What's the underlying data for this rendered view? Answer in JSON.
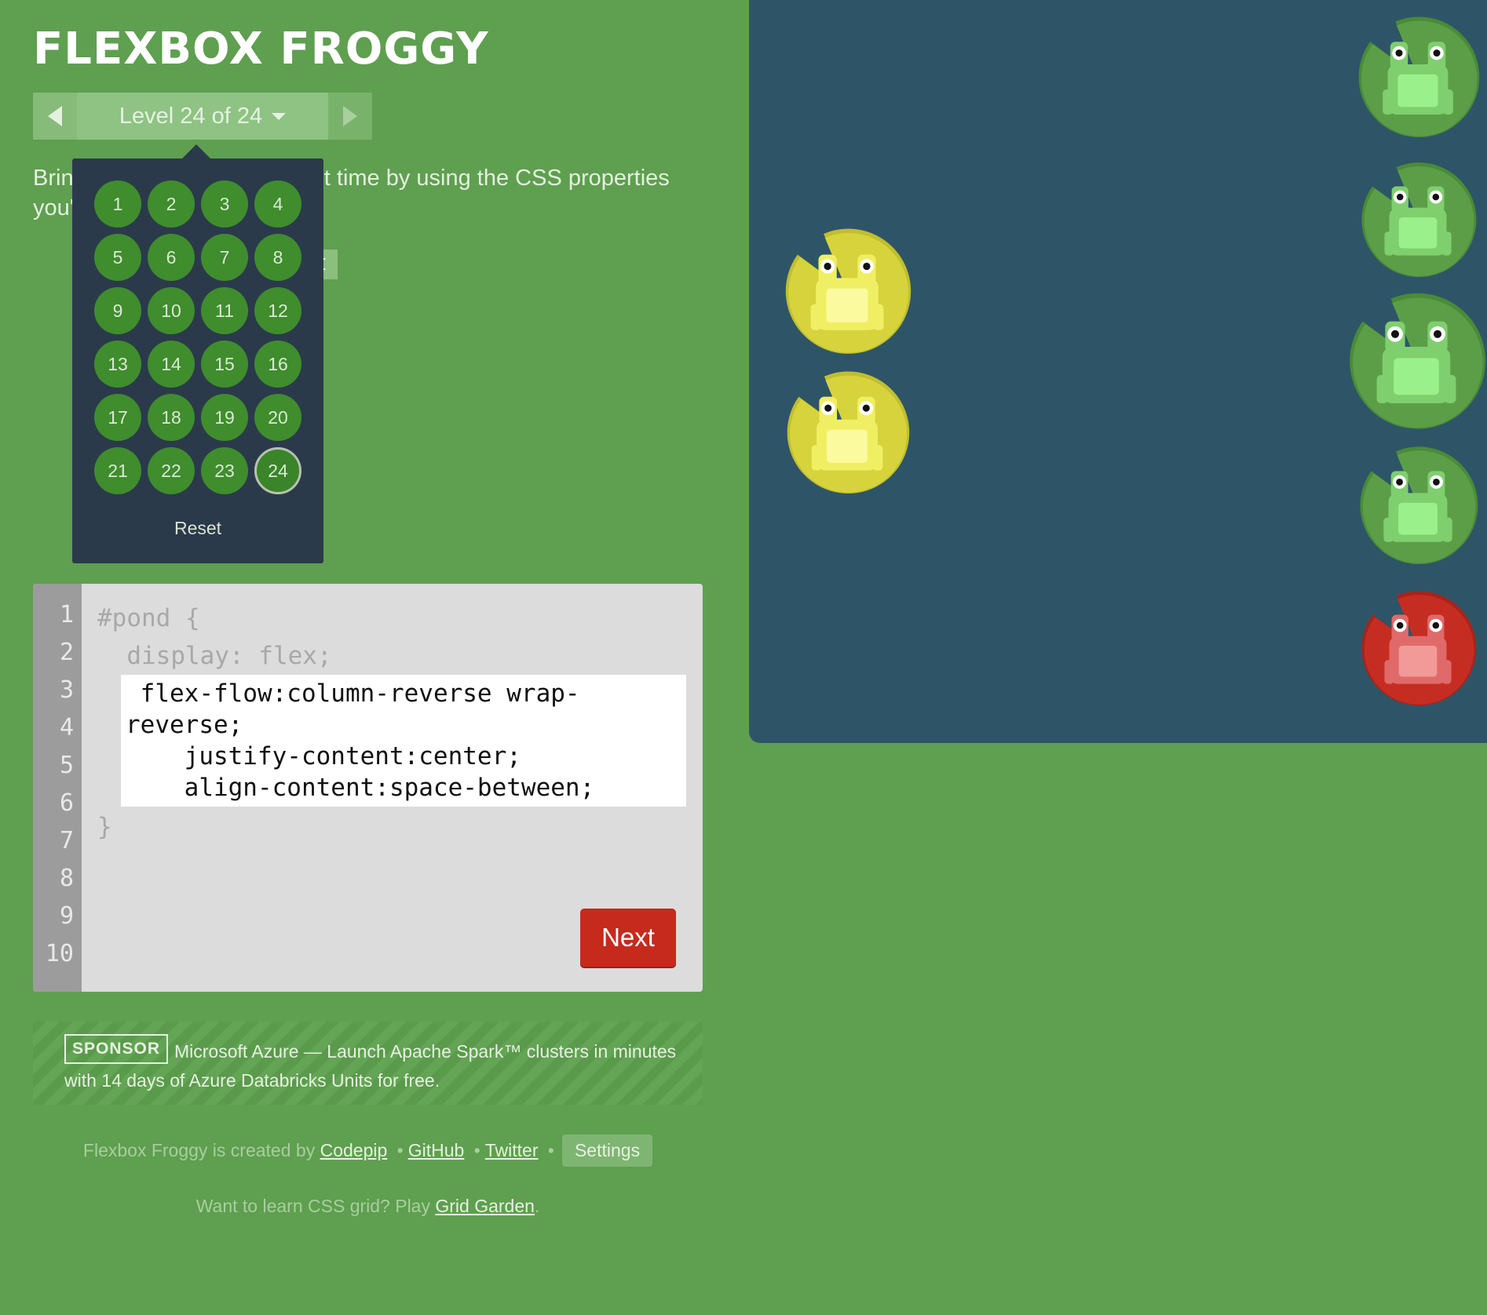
{
  "app": {
    "title": "FLEXBOX FROGGY"
  },
  "level_nav": {
    "prev_icon": "triangle-left-icon",
    "next_icon": "triangle-right-icon",
    "label": "Level 24 of 24",
    "caret_icon": "caret-down-icon"
  },
  "instructions": {
    "text": "Bring the frogs home one last time by using the CSS properties you've learned:"
  },
  "code_hint": {
    "text": "t"
  },
  "level_menu": {
    "levels": [
      "1",
      "2",
      "3",
      "4",
      "5",
      "6",
      "7",
      "8",
      "9",
      "10",
      "11",
      "12",
      "13",
      "14",
      "15",
      "16",
      "17",
      "18",
      "19",
      "20",
      "21",
      "22",
      "23",
      "24"
    ],
    "current": "24",
    "reset_label": "Reset"
  },
  "editor": {
    "line_numbers": [
      "1",
      "2",
      "3",
      "4",
      "5",
      "6",
      "7",
      "8",
      "9",
      "10"
    ],
    "line1": "#pond {",
    "line2": "  display: flex;",
    "closing": "}",
    "input_value": " flex-flow:column-reverse wrap-reverse;\n    justify-content:center;\n    align-content:space-between;",
    "next_label": "Next"
  },
  "sponsor": {
    "badge": "SPONSOR",
    "text": "Microsoft Azure — Launch Apache Spark™ clusters in minutes with 14 days of Azure Databricks Units for free."
  },
  "footer": {
    "created_by": "Flexbox Froggy is created by",
    "codepip": "Codepip",
    "github": "GitHub",
    "twitter": "Twitter",
    "settings": "Settings",
    "grid_prompt": "Want to learn CSS grid? Play",
    "grid_garden": "Grid Garden",
    "period": "."
  },
  "pond": {
    "water_color": "#2e5567",
    "frogs": [
      {
        "name": "frog-green-1",
        "color": "green"
      },
      {
        "name": "frog-green-2",
        "color": "green"
      },
      {
        "name": "frog-green-3",
        "color": "green"
      },
      {
        "name": "frog-green-4",
        "color": "green"
      },
      {
        "name": "frog-red",
        "color": "red"
      },
      {
        "name": "frog-yellow-1",
        "color": "yellow"
      },
      {
        "name": "frog-yellow-2",
        "color": "yellow"
      }
    ]
  },
  "colors": {
    "background": "#5f9f50",
    "green_pad": "#5c9e48",
    "yellow_pad": "#d6d33c",
    "red_pad": "#c62d22",
    "next_button": "#c52a1c"
  }
}
